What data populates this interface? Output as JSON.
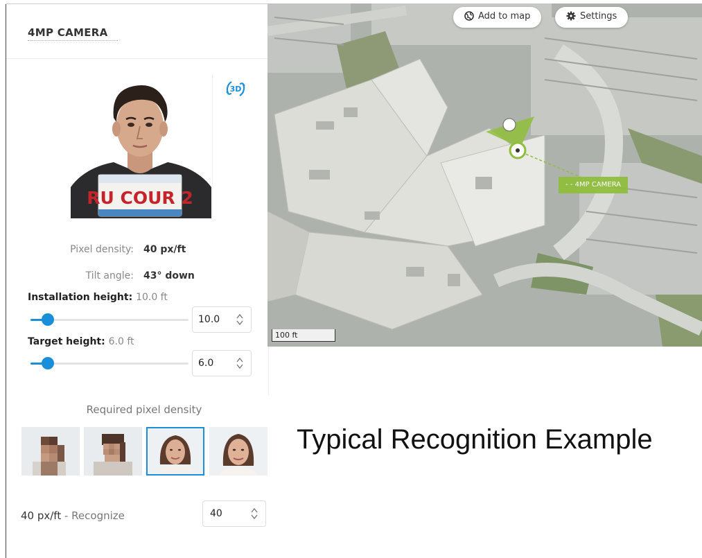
{
  "panel": {
    "title": "4MP CAMERA",
    "view_toggle": "3D"
  },
  "photo": {
    "plate_text": "RU COUR 2"
  },
  "metrics": {
    "pixel_density_label": "Pixel density:",
    "pixel_density_value": "40 px/ft",
    "tilt_label": "Tilt angle:",
    "tilt_value": "43° down"
  },
  "installation_height": {
    "label": "Installation height:",
    "value_text": "10.0 ft",
    "input_value": "10.0",
    "slider_fraction": 0.11
  },
  "target_height": {
    "label": "Target height:",
    "value_text": "6.0 ft",
    "input_value": "6.0",
    "slider_fraction": 0.11
  },
  "required_density": {
    "title": "Required pixel density",
    "selected_index": 2,
    "current_label": "40 px/ft",
    "current_suffix": "- Recognize",
    "input_value": "40"
  },
  "map": {
    "add_to_map": "Add to map",
    "settings": "Settings",
    "scale": "100 ft",
    "camera_label": "- - 4MP CAMERA"
  },
  "caption": "Typical Recognition Example",
  "colors": {
    "accent": "#1a8fd9",
    "camera_green": "#8fbe3b"
  }
}
